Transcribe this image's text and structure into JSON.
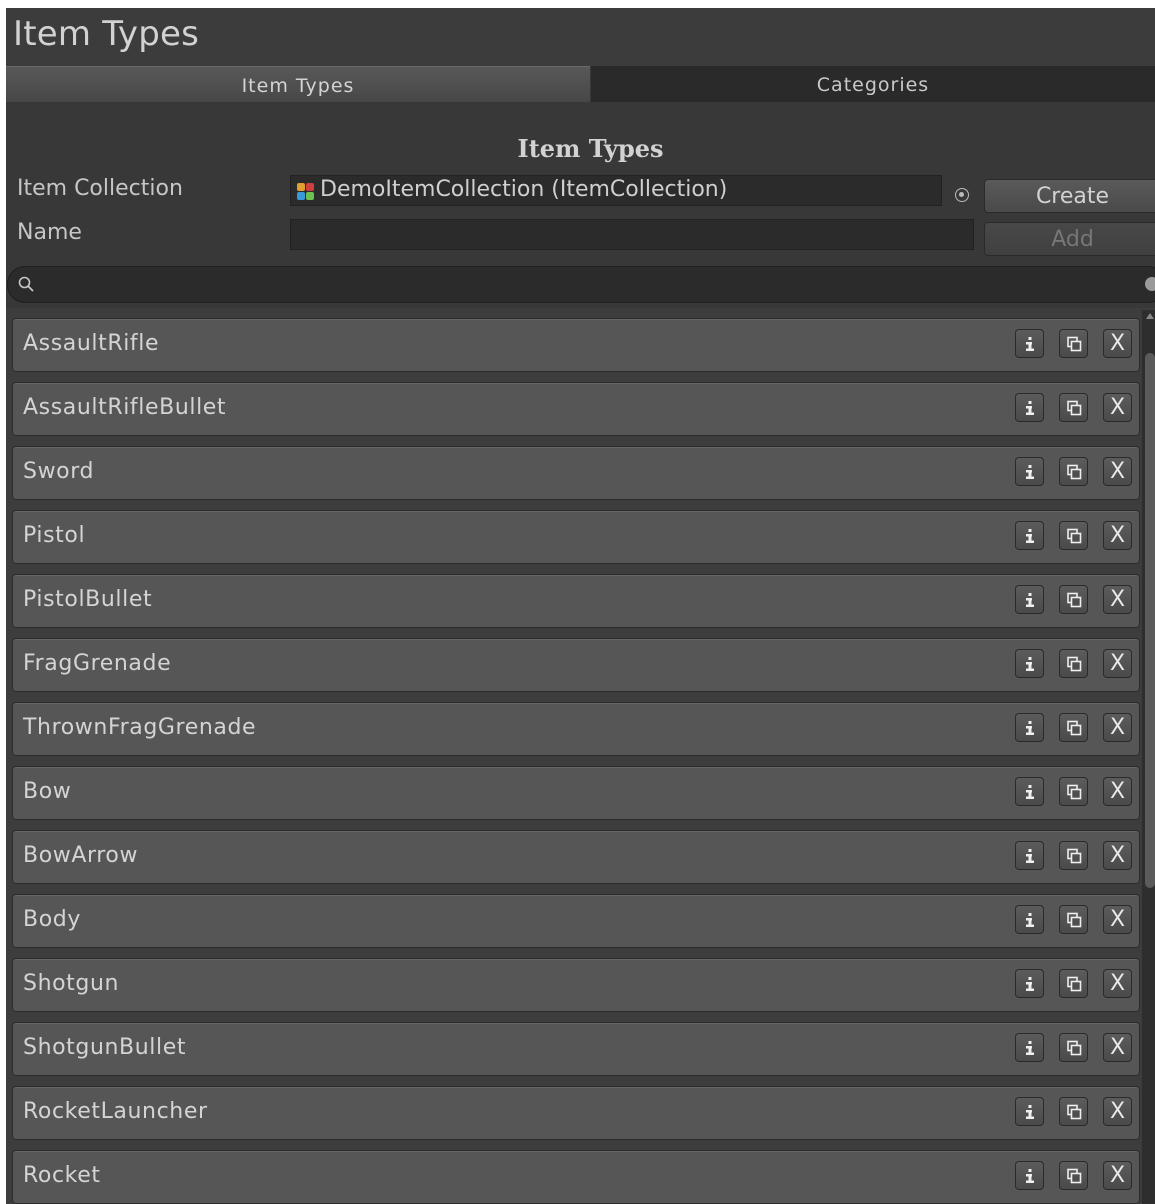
{
  "window": {
    "title": "Item Types"
  },
  "tabs": [
    {
      "label": "Item Types",
      "active": true
    },
    {
      "label": "Categories",
      "active": false
    }
  ],
  "section": {
    "heading": "Item Types"
  },
  "form": {
    "collection_label": "Item Collection",
    "collection_value": "DemoItemCollection (ItemCollection)",
    "name_label": "Name",
    "name_value": "",
    "create_label": "Create",
    "add_label": "Add"
  },
  "search": {
    "value": "",
    "icon": "search-icon"
  },
  "items": [
    {
      "label": "AssaultRifle"
    },
    {
      "label": "AssaultRifleBullet"
    },
    {
      "label": "Sword"
    },
    {
      "label": "Pistol"
    },
    {
      "label": "PistolBullet"
    },
    {
      "label": "FragGrenade"
    },
    {
      "label": "ThrownFragGrenade"
    },
    {
      "label": "Bow"
    },
    {
      "label": "BowArrow"
    },
    {
      "label": "Body"
    },
    {
      "label": "Shotgun"
    },
    {
      "label": "ShotgunBullet"
    },
    {
      "label": "RocketLauncher"
    },
    {
      "label": "Rocket"
    }
  ],
  "row_actions": {
    "info_icon": "info-icon",
    "duplicate_icon": "duplicate-icon",
    "remove_label": "X"
  },
  "colors": {
    "background": "#383838",
    "row": "#565656",
    "field": "#2b2b2b",
    "inactive_tab": "#2a2a2a"
  }
}
